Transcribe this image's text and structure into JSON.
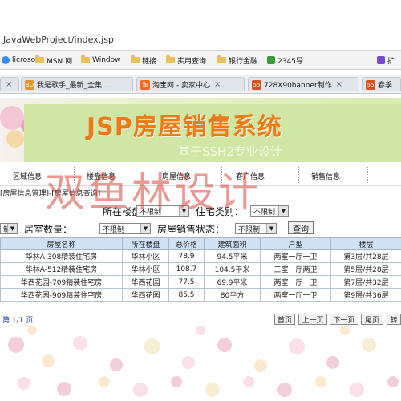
{
  "address_bar": {
    "url": "JavaWebProject/index.jsp"
  },
  "favorites": [
    {
      "label": "licroso",
      "icon": "ie-icon"
    },
    {
      "label": "MSN 网",
      "icon": "folder-icon"
    },
    {
      "label": "Window",
      "icon": "folder-icon"
    },
    {
      "label": "链接",
      "icon": "folder-icon"
    },
    {
      "label": "实用查询",
      "icon": "folder-icon"
    },
    {
      "label": "银行金融",
      "icon": "folder-icon"
    },
    {
      "label": "2345导",
      "icon": "2345-icon"
    },
    {
      "label": "扩",
      "icon": "extension-icon"
    }
  ],
  "tabs": [
    {
      "label": "我是歌手_最新_全集 ...",
      "icon_text": "BQ",
      "icon_color": "#e8932a"
    },
    {
      "label": "淘宝网 - 卖家中心",
      "icon_text": "淘",
      "icon_color": "#f26b1d"
    },
    {
      "label": "728X90banner制作",
      "icon_text": "55",
      "icon_color": "#d9531e"
    },
    {
      "label": "春季",
      "icon_text": "55",
      "icon_color": "#d9531e"
    }
  ],
  "banner": {
    "title": "JSP房屋销售系统",
    "subtitle": "基于SSH2专业设计"
  },
  "nav": [
    "区域信息",
    "楼盘信息",
    "房屋信息",
    "客户信息",
    "销售信息"
  ],
  "breadcrumb": "[房屋信息管理]-[房屋信息查询]",
  "filters": {
    "building_label": "所在楼盘：",
    "building_value": "不限制",
    "type_label": "住宅类别：",
    "type_value": "不限制",
    "left_value": "制",
    "rooms_label": "居室数量：",
    "rooms_value": "不限制",
    "status_label": "房屋销售状态：",
    "status_value": "不限制",
    "query_label": "查询"
  },
  "table": {
    "headers": [
      "房屋名称",
      "所在楼盘",
      "总价格",
      "建筑面积",
      "户型",
      "楼层"
    ],
    "rows": [
      [
        "华林A-308精装住宅房",
        "华林小区",
        "78.9",
        "94.5平米",
        "两室一厅一卫",
        "第3层/共28层"
      ],
      [
        "华林A-512精装住宅房",
        "华林小区",
        "108.7",
        "104.5平米",
        "三室一厅两卫",
        "第5层/共28层"
      ],
      [
        "华西花园-709精装住宅房",
        "华西花园",
        "77.5",
        "69.9平米",
        "两室一厅一卫",
        "第7层/共32层"
      ],
      [
        "华西花园-909精装住宅房",
        "华西花园",
        "85.5",
        "80平方",
        "两室一厅一卫",
        "第9层/共36层"
      ]
    ]
  },
  "pager": {
    "info": "第 1/1 页",
    "first": "首页",
    "prev": "上一页",
    "next": "下一页",
    "last": "尾页",
    "goto": "转"
  },
  "watermark": "双鱼林设计"
}
